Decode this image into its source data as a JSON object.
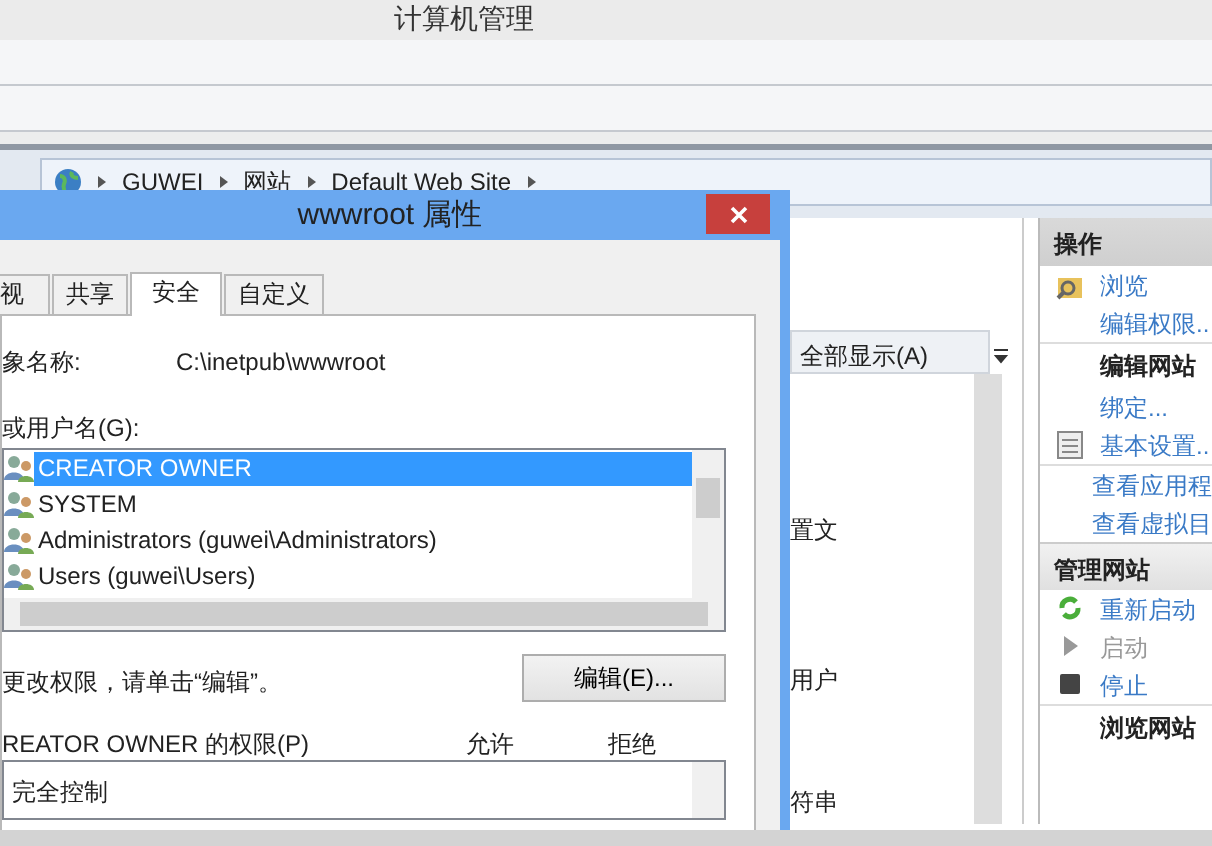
{
  "window": {
    "title": "计算机管理"
  },
  "breadcrumb": [
    "GUWEI",
    "网站",
    "Default Web Site"
  ],
  "features": {
    "show_all_button": "全部显示(A)",
    "items": [
      {
        "label": "置文"
      },
      {
        "label": "用户"
      },
      {
        "label": "符串"
      }
    ]
  },
  "actions": [
    {
      "title": "操作",
      "groups": [
        {
          "items": [
            {
              "label": "浏览",
              "disabled": false
            },
            {
              "label": "编辑权限..",
              "disabled": false
            }
          ]
        },
        {
          "heading": "编辑网站",
          "items": [
            {
              "label": "绑定...",
              "disabled": false
            },
            {
              "label": "基本设置..",
              "disabled": false
            }
          ]
        },
        {
          "items": [
            {
              "label": "查看应用程",
              "disabled": false
            },
            {
              "label": "查看虚拟目",
              "disabled": false
            }
          ]
        }
      ]
    },
    {
      "title": "管理网站",
      "groups": [
        {
          "items": [
            {
              "label": "重新启动",
              "disabled": false
            },
            {
              "label": "启动",
              "disabled": true
            },
            {
              "label": "停止",
              "disabled": false
            }
          ]
        },
        {
          "heading": "浏览网站"
        }
      ]
    }
  ],
  "dialog": {
    "title": "wwwroot 属性",
    "tabs": [
      {
        "label": "视",
        "selected": false
      },
      {
        "label": "共享",
        "selected": false
      },
      {
        "label": "安全",
        "selected": true
      },
      {
        "label": "自定义",
        "selected": false
      }
    ],
    "object_label": "象名称:",
    "object_value": "C:\\inetpub\\wwwroot",
    "users_label": "或用户名(G):",
    "users": [
      {
        "name": "CREATOR OWNER",
        "selected": true
      },
      {
        "name": "SYSTEM",
        "selected": false
      },
      {
        "name": "Administrators (guwei\\Administrators)",
        "selected": false
      },
      {
        "name": "Users (guwei\\Users)",
        "selected": false
      }
    ],
    "edit_hint": "更改权限，请单击“编辑”。",
    "edit_button": "编辑(E)...",
    "permissions_label": "REATOR OWNER 的权限(P)",
    "allow_header": "允许",
    "deny_header": "拒绝",
    "permissions": [
      "完全控制"
    ]
  }
}
